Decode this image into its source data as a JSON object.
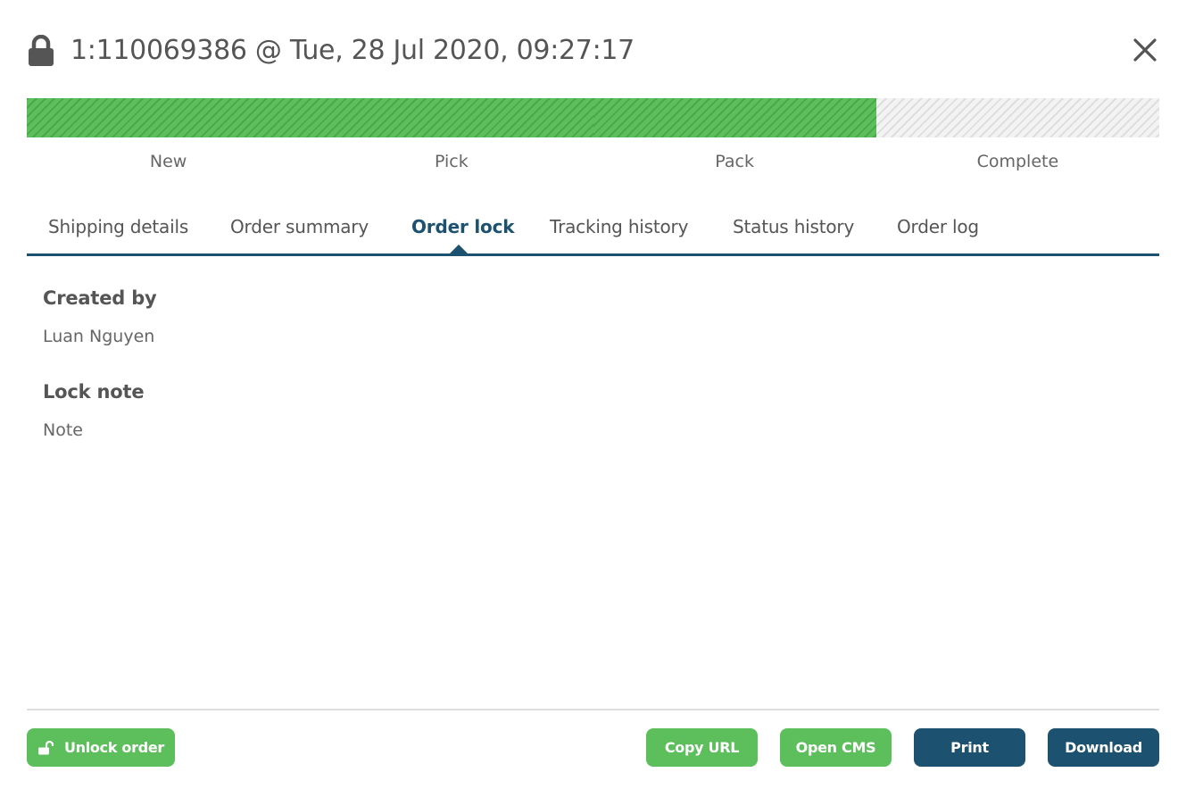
{
  "header": {
    "title": "1:110069386 @ Tue, 28 Jul 2020, 09:27:17",
    "lock_icon": "lock-icon",
    "close_icon": "close-icon"
  },
  "progress": {
    "steps": [
      "New",
      "Pick",
      "Pack",
      "Complete"
    ],
    "completed_steps": 3,
    "colors": {
      "done": "#5cbf5c",
      "todo": "#f3f3f3"
    }
  },
  "tabs": {
    "items": [
      "Shipping details",
      "Order summary",
      "Order lock",
      "Tracking history",
      "Status history",
      "Order log"
    ],
    "active": "Order lock"
  },
  "order_lock": {
    "created_by_label": "Created by",
    "created_by_value": "Luan Nguyen",
    "lock_note_label": "Lock note",
    "lock_note_value": "Note"
  },
  "footer": {
    "unlock_label": "Unlock order",
    "unlock_icon": "unlock-icon",
    "copy_url_label": "Copy URL",
    "open_cms_label": "Open CMS",
    "print_label": "Print",
    "download_label": "Download"
  },
  "colors": {
    "accent": "#1d5170",
    "success": "#5cbf5c",
    "text": "#555555"
  }
}
